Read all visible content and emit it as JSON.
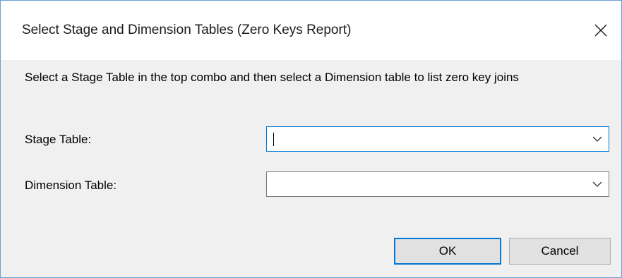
{
  "window": {
    "title": "Select Stage and Dimension Tables (Zero Keys Report)"
  },
  "description": "Select a Stage Table in the top combo and then select a Dimension table to list zero key joins",
  "fields": {
    "stage_table": {
      "label": "Stage Table:",
      "value": ""
    },
    "dimension_table": {
      "label": "Dimension Table:",
      "value": ""
    }
  },
  "buttons": {
    "ok_label": "OK",
    "cancel_label": "Cancel"
  },
  "icons": {
    "close": "close-icon",
    "dropdown": "chevron-down-icon"
  },
  "colors": {
    "accent": "#0078d7",
    "dialog_background": "#f0f0f0",
    "title_background": "#ffffff"
  }
}
